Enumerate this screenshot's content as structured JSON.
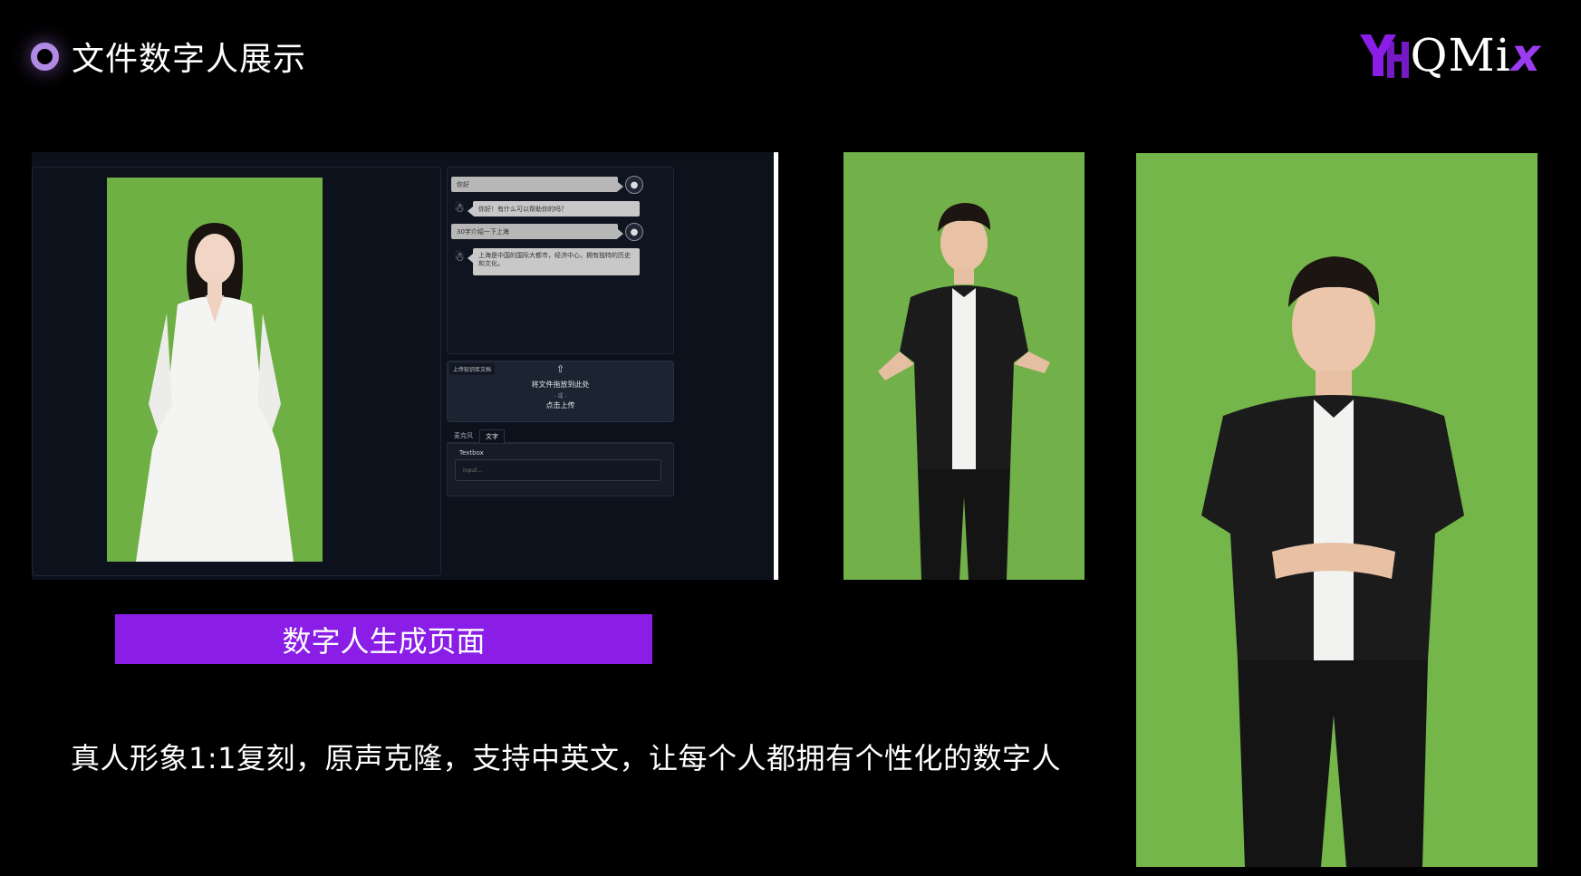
{
  "header": {
    "title": "文件数字人展示"
  },
  "logo": {
    "brand_main": "QMi",
    "brand_accent": "x",
    "mark": "YH"
  },
  "app": {
    "chat": [
      {
        "role": "user",
        "text": "你好"
      },
      {
        "role": "bot",
        "text": "你好！有什么可以帮助你的吗？"
      },
      {
        "role": "user",
        "text": "30字介绍一下上海"
      },
      {
        "role": "bot",
        "text": "上海是中国的国际大都市，经济中心，拥有独特的历史和文化。"
      }
    ],
    "upload": {
      "tag": "上传知识库文档",
      "drop_text": "将文件拖放到此处",
      "or_text": "- 或 -",
      "click_text": "点击上传"
    },
    "tabs": [
      {
        "label": "麦克风"
      },
      {
        "label": "文字"
      }
    ],
    "textbox": {
      "label": "Textbox",
      "placeholder": "input..."
    }
  },
  "caption": {
    "text": "数字人生成页面"
  },
  "tagline": {
    "text": "真人形象1:1复刻，原声克隆，支持中英文，让每个人都拥有个性化的数字人"
  },
  "colors": {
    "accent_purple": "#8a1de6",
    "chroma_green": "#72b049",
    "app_bg": "#0c111c"
  }
}
